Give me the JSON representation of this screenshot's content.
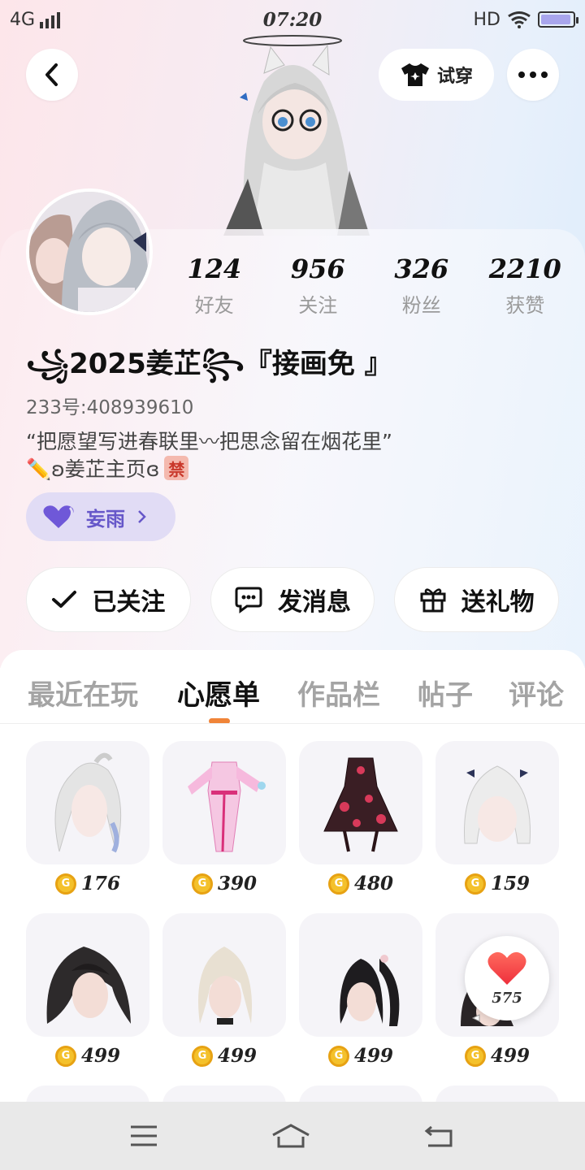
{
  "status_bar": {
    "network": "4G",
    "time": "07:20",
    "hd": "HD",
    "battery_level": 0.95
  },
  "header": {
    "back_icon": "chevron-left-icon",
    "tryon_label": "试穿",
    "more_icon": "more-dots-icon"
  },
  "stats": [
    {
      "value": "124",
      "label": "好友"
    },
    {
      "value": "956",
      "label": "关注"
    },
    {
      "value": "326",
      "label": "粉丝"
    },
    {
      "value": "2210",
      "label": "获赞"
    }
  ],
  "profile": {
    "nickname": "꧁2025姜芷꧂『接画免 』",
    "uid": "233号:408939610",
    "bio_line1": "“把愿望写进春联里〰把思念留在烟花里”",
    "bio_line2": "✏️ʚ姜芷主页ɞ",
    "ban_badge": "禁",
    "guard_name": "妄雨"
  },
  "actions": {
    "follow": "已关注",
    "message": "发消息",
    "gift": "送礼物"
  },
  "tabs": [
    {
      "label": "最近在玩",
      "active": false
    },
    {
      "label": "心愿单",
      "active": true
    },
    {
      "label": "作品栏",
      "active": false
    },
    {
      "label": "帖子",
      "active": false
    },
    {
      "label": "评论",
      "active": false
    }
  ],
  "wishlist": [
    {
      "name": "white-ponytail-hair",
      "price": "176"
    },
    {
      "name": "pink-qipao-outfit",
      "price": "390"
    },
    {
      "name": "black-red-dress",
      "price": "480"
    },
    {
      "name": "white-long-hair-bows",
      "price": "159"
    },
    {
      "name": "black-wavy-hair",
      "price": "499"
    },
    {
      "name": "blonde-long-hair",
      "price": "499"
    },
    {
      "name": "black-twin-tail-hair",
      "price": "499"
    },
    {
      "name": "dark-hair-ribbons",
      "price": "499"
    }
  ],
  "like_float": {
    "count": "575"
  },
  "colors": {
    "accent_orange": "#f08438",
    "guard_purple": "#6657c9",
    "coin_gold": "#f4c12b",
    "heart_red": "#f23b3b"
  }
}
